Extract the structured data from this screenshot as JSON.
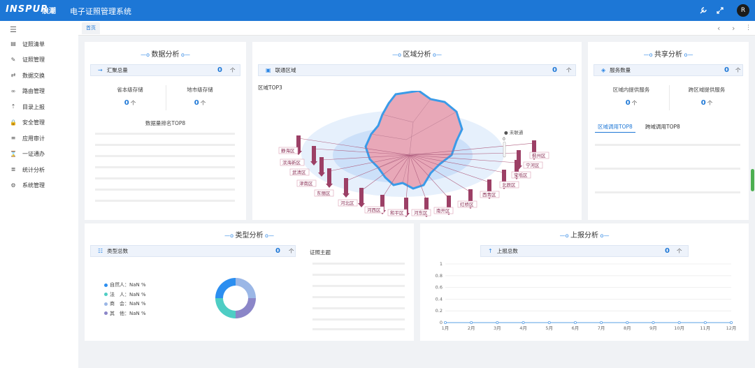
{
  "header": {
    "logo_text": "INSPUR",
    "logo_cn": "浪潮",
    "title": "电子证照管理系统",
    "avatar_letter": "R",
    "icons": [
      "wrench-icon",
      "expand-icon"
    ]
  },
  "sidebar": {
    "items": [
      {
        "label": "证照清单",
        "icon": "list-book-icon"
      },
      {
        "label": "证照管理",
        "icon": "pencil-icon"
      },
      {
        "label": "数据交换",
        "icon": "exchange-icon"
      },
      {
        "label": "路由管理",
        "icon": "link-icon"
      },
      {
        "label": "目录上报",
        "icon": "upload-icon"
      },
      {
        "label": "安全管理",
        "icon": "lock-icon"
      },
      {
        "label": "应用审计",
        "icon": "audit-icon"
      },
      {
        "label": "一证通办",
        "icon": "hourglass-icon"
      },
      {
        "label": "统计分析",
        "icon": "stats-icon"
      },
      {
        "label": "系统管理",
        "icon": "gear-icon"
      }
    ]
  },
  "tabs": {
    "home": "首页"
  },
  "data_analysis": {
    "title": "数据分析",
    "summary_label": "汇聚总量",
    "summary_value": "0",
    "unit": "个",
    "provincial_label": "省本级存储",
    "provincial_value": "0",
    "municipal_label": "地市级存储",
    "municipal_value": "0",
    "ranking_title": "数据量排名TOP8"
  },
  "region_analysis": {
    "title": "区域分析",
    "summary_label": "联通区域",
    "summary_value": "0",
    "unit": "个",
    "top_label": "区域TOP3",
    "not_connected": "未联通",
    "scale_value": "0",
    "districts": [
      "静海区",
      "滨海新区",
      "武清区",
      "津南区",
      "东丽区",
      "河北区",
      "河西区",
      "和平区",
      "河东区",
      "南开区",
      "红桥区",
      "西青区",
      "北辰区",
      "宝坻区",
      "宁河区",
      "蓟州区"
    ]
  },
  "share_analysis": {
    "title": "共享分析",
    "summary_label": "服务数量",
    "summary_value": "0",
    "unit": "个",
    "inner_label": "区域内提供服务",
    "inner_value": "0",
    "cross_label": "跨区域提供服务",
    "cross_value": "0",
    "tab_region": "区域调用TOP8",
    "tab_cross": "跨域调用TOP8"
  },
  "type_analysis": {
    "title": "类型分析",
    "summary_label": "类型总数",
    "summary_value": "0",
    "unit": "个",
    "theme_label": "证照主题",
    "legend": [
      {
        "label": "自然人：NaN %",
        "color": "#2b8ef0"
      },
      {
        "label": "法　人：NaN %",
        "color": "#4ecdc4"
      },
      {
        "label": "商　会：NaN %",
        "color": "#9bb7e6"
      },
      {
        "label": "其　他：NaN %",
        "color": "#8b86c8"
      }
    ]
  },
  "report_analysis": {
    "title": "上报分析",
    "summary_label": "上报总数",
    "summary_value": "0",
    "unit": "个"
  },
  "chart_data": {
    "type": "line",
    "categories": [
      "1月",
      "2月",
      "3月",
      "4月",
      "5月",
      "6月",
      "7月",
      "8月",
      "9月",
      "10月",
      "11月",
      "12月"
    ],
    "series": [
      {
        "values": [
          0,
          0,
          0,
          0,
          0,
          0,
          0,
          0,
          0,
          0,
          0,
          0
        ]
      }
    ],
    "yticks": [
      "0",
      "0.2",
      "0.4",
      "0.6",
      "0.8",
      "1"
    ],
    "ylim": [
      0,
      1
    ],
    "grid": true,
    "color": "#5aa0e6"
  }
}
